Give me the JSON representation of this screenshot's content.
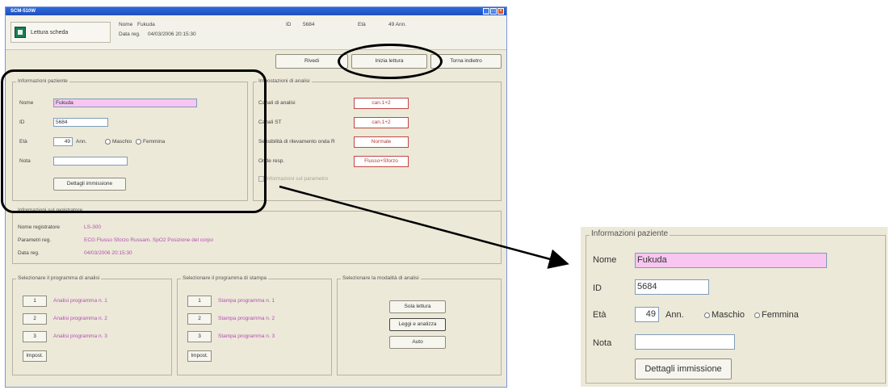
{
  "window": {
    "title": "SCM-510W"
  },
  "header": {
    "lettura_label": "Lettura scheda",
    "nome_label": "Nome",
    "nome_value": "Fukuda",
    "datareg_label": "Data reg.",
    "datareg_value": "04/03/2006 20:15:30",
    "id_label": "ID",
    "id_value": "5684",
    "eta_label": "Età",
    "eta_value": "49 Ann."
  },
  "toolbar": {
    "rivedi": "Rivedi",
    "inizia": "Inizia lettura",
    "torna": "Torna indietro"
  },
  "patient": {
    "title": "Informazioni paziente",
    "nome_label": "Nome",
    "nome_value": "Fukuda",
    "id_label": "ID",
    "id_value": "5684",
    "eta_label": "Età",
    "eta_value": "49",
    "anni_label": "Ann.",
    "maschio": "Maschio",
    "femmina": "Femmina",
    "nota_label": "Nota",
    "nota_value": "",
    "dettagli_button": "Dettagli immissione"
  },
  "analysis": {
    "title": "Impostazioni di analisi",
    "canali_label": "Canali di analisi",
    "canali_value": "can.1+2",
    "canali_st_label": "Canali ST",
    "canali_st_value": "can.1+2",
    "sens_label": "Sensibilità di rilevamento onda R",
    "sens_value": "Normale",
    "onde_label": "Onde resp.",
    "onde_value": "Flusso+Sforzo",
    "info_label": "Informazioni sul parametro"
  },
  "recorder": {
    "title": "Informazioni sul registratore",
    "nome_label": "Nome registratore",
    "nome_value": "LS-300",
    "param_label": "Parametri reg.",
    "param_value": "ECG Flusso Sforzo Russam. SpO2 Posizione del corpo",
    "data_label": "Data reg.",
    "data_value": "04/03/2006 20:15:30"
  },
  "prog_analisi": {
    "title": "Selezionare il programma di analisi",
    "items": [
      {
        "num": "1",
        "label": "Analisi programma n. 1"
      },
      {
        "num": "2",
        "label": "Analisi programma n. 2"
      },
      {
        "num": "3",
        "label": "Analisi programma n. 3"
      }
    ],
    "impost": "Impost."
  },
  "prog_stampa": {
    "title": "Selezionare il programma di stampa",
    "items": [
      {
        "num": "1",
        "label": "Stampa programma n. 1"
      },
      {
        "num": "2",
        "label": "Stampa programma n. 2"
      },
      {
        "num": "3",
        "label": "Stampa programma n. 3"
      }
    ],
    "impost": "Impost."
  },
  "modalita": {
    "title": "Selezionare la modalità di analisi",
    "sola": "Sola lettura",
    "leggi": "Leggi e analizza",
    "auto": "Auto"
  },
  "zoom": {
    "title": "Informazioni paziente",
    "nome_label": "Nome",
    "nome_value": "Fukuda",
    "id_label": "ID",
    "id_value": "5684",
    "eta_label": "Età",
    "eta_value": "49",
    "anni_label": "Ann.",
    "maschio": "Maschio",
    "femmina": "Femmina",
    "nota_label": "Nota",
    "dettagli_button": "Dettagli immissione"
  }
}
